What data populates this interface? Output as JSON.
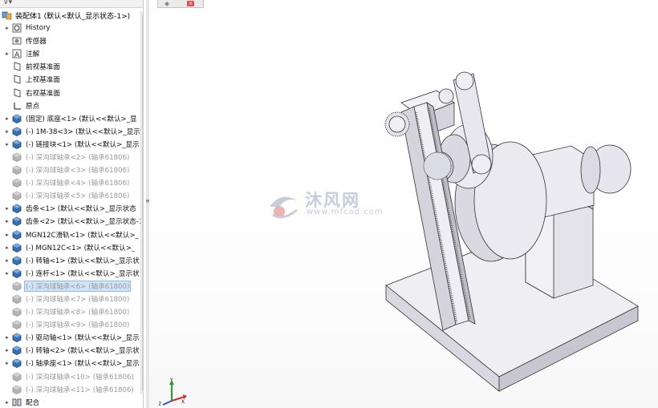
{
  "tree": {
    "root_label": "装配体1 (默认<默认_显示状态-1>)",
    "items": [
      {
        "label": "History",
        "icon": "history-icon",
        "arrow": "▸",
        "state": "normal"
      },
      {
        "label": "传感器",
        "icon": "sensor-icon",
        "arrow": "",
        "state": "normal"
      },
      {
        "label": "注解",
        "icon": "annotation-icon",
        "arrow": "▸",
        "state": "normal"
      },
      {
        "label": "前视基准面",
        "icon": "plane-icon",
        "arrow": "",
        "state": "normal"
      },
      {
        "label": "上视基准面",
        "icon": "plane-icon",
        "arrow": "",
        "state": "normal"
      },
      {
        "label": "右视基准面",
        "icon": "plane-icon",
        "arrow": "",
        "state": "normal"
      },
      {
        "label": "原点",
        "icon": "origin-icon",
        "arrow": "",
        "state": "normal"
      },
      {
        "label": "(固定) 底座<1> (默认<<默认>_显",
        "icon": "part-icon",
        "arrow": "▸",
        "state": "normal"
      },
      {
        "label": "(-) 1M-38<3> (默认<<默认>_显示",
        "icon": "part-icon",
        "arrow": "▸",
        "state": "normal"
      },
      {
        "label": "(-) 链接块<1> (默认<<默认>_显示",
        "icon": "part-icon",
        "arrow": "▸",
        "state": "normal"
      },
      {
        "label": "(-) 深沟球轴承<2> (轴承61806)",
        "icon": "part-icon",
        "arrow": "",
        "state": "suppressed"
      },
      {
        "label": "(-) 深沟球轴承<3> (轴承61806)",
        "icon": "part-icon",
        "arrow": "",
        "state": "suppressed"
      },
      {
        "label": "(-) 深沟球轴承<4> (轴承61806)",
        "icon": "part-icon",
        "arrow": "",
        "state": "suppressed"
      },
      {
        "label": "(-) 深沟球轴承<5> (轴承61806)",
        "icon": "part-icon",
        "arrow": "",
        "state": "suppressed"
      },
      {
        "label": "齿条<1> (默认<<默认>_显示状态",
        "icon": "part-icon",
        "arrow": "▸",
        "state": "normal"
      },
      {
        "label": "齿条<2> (默认<<默认>_显示状态-1",
        "icon": "part-icon",
        "arrow": "▸",
        "state": "normal"
      },
      {
        "label": "MGN12C滑轨<1> (默认<<默认>_",
        "icon": "part-icon",
        "arrow": "▸",
        "state": "normal"
      },
      {
        "label": "(-) MGN12C<1> (默认<<默认>_",
        "icon": "part-icon",
        "arrow": "▸",
        "state": "normal"
      },
      {
        "label": "(-) 转轴<1> (默认<<默认>_显示状",
        "icon": "part-icon",
        "arrow": "▸",
        "state": "normal"
      },
      {
        "label": "(-) 连杆<1> (默认<<默认>_显示状",
        "icon": "part-icon",
        "arrow": "▸",
        "state": "normal"
      },
      {
        "label": "(-) 深沟球轴承<6> (轴承61800)",
        "icon": "part-icon",
        "arrow": "",
        "state": "suppressed-selected"
      },
      {
        "label": "(-) 深沟球轴承<7> (轴承61800)",
        "icon": "part-icon",
        "arrow": "",
        "state": "suppressed"
      },
      {
        "label": "(-) 深沟球轴承<8> (轴承61800)",
        "icon": "part-icon",
        "arrow": "",
        "state": "suppressed"
      },
      {
        "label": "(-) 深沟球轴承<9> (轴承61800)",
        "icon": "part-icon",
        "arrow": "",
        "state": "suppressed"
      },
      {
        "label": "(-) 驱动轴<1> (默认<<默认>_显示",
        "icon": "part-icon",
        "arrow": "▸",
        "state": "normal"
      },
      {
        "label": "(-) 转轴<2> (默认<<默认>_显示状",
        "icon": "part-icon",
        "arrow": "▸",
        "state": "normal"
      },
      {
        "label": "(-) 轴承座<1> (默认<<默认>_显示",
        "icon": "part-icon",
        "arrow": "▸",
        "state": "normal"
      },
      {
        "label": "(-) 深沟球轴承<10> (轴承61806)",
        "icon": "part-icon",
        "arrow": "",
        "state": "suppressed"
      },
      {
        "label": "(-) 深沟球轴承<11> (轴承61806)",
        "icon": "part-icon",
        "arrow": "",
        "state": "suppressed"
      },
      {
        "label": "配合",
        "icon": "mates-icon",
        "arrow": "▸",
        "state": "normal"
      }
    ]
  },
  "watermark": {
    "text": "沐风网",
    "url": "www.mfcad.com"
  },
  "triad": {
    "x": "X",
    "y": "Y",
    "z": "Z"
  },
  "colors": {
    "selection": "#cfe4f7",
    "part_blue": "#3a6fb0",
    "suppressed": "#9a9a9a"
  }
}
